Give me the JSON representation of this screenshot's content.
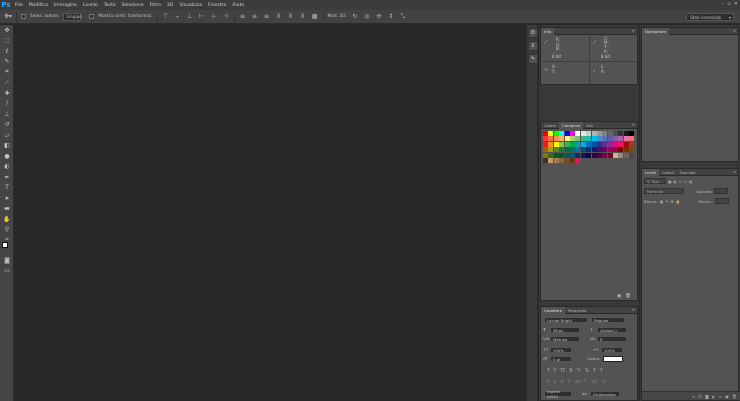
{
  "app": {
    "logo": "Ps",
    "menu": [
      "File",
      "Modifica",
      "Immagine",
      "Livello",
      "Testo",
      "Selezione",
      "Filtro",
      "3D",
      "Visualizza",
      "Finestra",
      "Aiuto"
    ],
    "window_controls": [
      "–",
      "▫",
      "✕"
    ]
  },
  "options": {
    "auto_select_label": "Selez. autom.",
    "auto_select_value": "Gruppo",
    "show_transform_label": "Mostra contr. trasformaz.",
    "mode_3d_label": "Mod. 3D:",
    "workspace": "Stati essenziali"
  },
  "info_panel": {
    "tabs": [
      "Info"
    ],
    "rgb_labels": "R:\nG:\nB:",
    "cmyk_labels": "C:\nM:\nY:\nK:",
    "bit_left": "8 bit",
    "bit_right": "8 bit",
    "xy_labels": "X:\nY:",
    "wh_labels": "L:\nA:"
  },
  "swatch_panel": {
    "tabs": [
      "Colore",
      "Campioni",
      "Stili"
    ],
    "active_tab": 1,
    "swatches": [
      "#ff0000",
      "#ffff00",
      "#00ff00",
      "#00ffff",
      "#0000ff",
      "#ff00ff",
      "#ffffff",
      "#e6e6e6",
      "#cccccc",
      "#b3b3b3",
      "#999999",
      "#808080",
      "#666666",
      "#4d4d4d",
      "#333333",
      "#1a1a1a",
      "#000000",
      "#ff3333",
      "#f26c4f",
      "#f68e56",
      "#fbaf5d",
      "#fff467",
      "#acd372",
      "#7dc473",
      "#3cb878",
      "#1cbbb4",
      "#00bff3",
      "#448ccb",
      "#5574b9",
      "#605ca8",
      "#855fa8",
      "#a763a8",
      "#f06ea9",
      "#f26d7d",
      "#ed1c24",
      "#f7941d",
      "#fff200",
      "#8dc73f",
      "#39b54a",
      "#00a651",
      "#00a99d",
      "#00aeef",
      "#0072bc",
      "#0054a6",
      "#2e3192",
      "#662d91",
      "#92278f",
      "#ec008c",
      "#ed145b",
      "#9e0b0f",
      "#a0410d",
      "#a36209",
      "#aba000",
      "#598527",
      "#197b30",
      "#007236",
      "#00746b",
      "#0076a3",
      "#004b80",
      "#003471",
      "#1b1464",
      "#440e62",
      "#630460",
      "#9e005d",
      "#9e0039",
      "#790000",
      "#7b2e00",
      "#7d4900",
      "#827b00",
      "#406618",
      "#005e20",
      "#005826",
      "#005952",
      "#005b7f",
      "#003663",
      "#002157",
      "#0d004c",
      "#32004b",
      "#4b0049",
      "#7b0046",
      "#7a0026",
      "#c7b299",
      "#998675",
      "#736357",
      "#534741",
      "#37302d",
      "#c69c6d",
      "#a67c52",
      "#8c6239",
      "#754c24",
      "#603913",
      "#ed145b"
    ]
  },
  "navigator_panel": {
    "tabs": [
      "Navigatore"
    ]
  },
  "layers_panel": {
    "tabs": [
      "Livelli",
      "Canali",
      "Tracciati"
    ],
    "filter_label": "Tipo",
    "blend_mode": "Normale",
    "opacity_label": "Opacità:",
    "lock_label": "Blocca:",
    "fill_label": "Riemp.:"
  },
  "character_panel": {
    "tabs": [
      "Carattere",
      "Paragrafo"
    ],
    "font_family": "Lucida Bright",
    "font_style": "Regular",
    "size": "36 pt",
    "leading": "(Autom.)",
    "kerning": "Metrica",
    "tracking": "0",
    "vscale": "100%",
    "hscale": "100%",
    "baseline": "0 pt",
    "color_label": "Colore:",
    "styles": [
      "T",
      "T",
      "TT",
      "Tr",
      "T¹",
      "T₁",
      "T",
      "T"
    ],
    "opentype": [
      "fi",
      "ơ",
      "st",
      "A",
      "ad",
      "T",
      "1st",
      "½"
    ],
    "language": "Inglese (USA)",
    "aa_label": "aa",
    "antialias": "Arrotondato"
  }
}
